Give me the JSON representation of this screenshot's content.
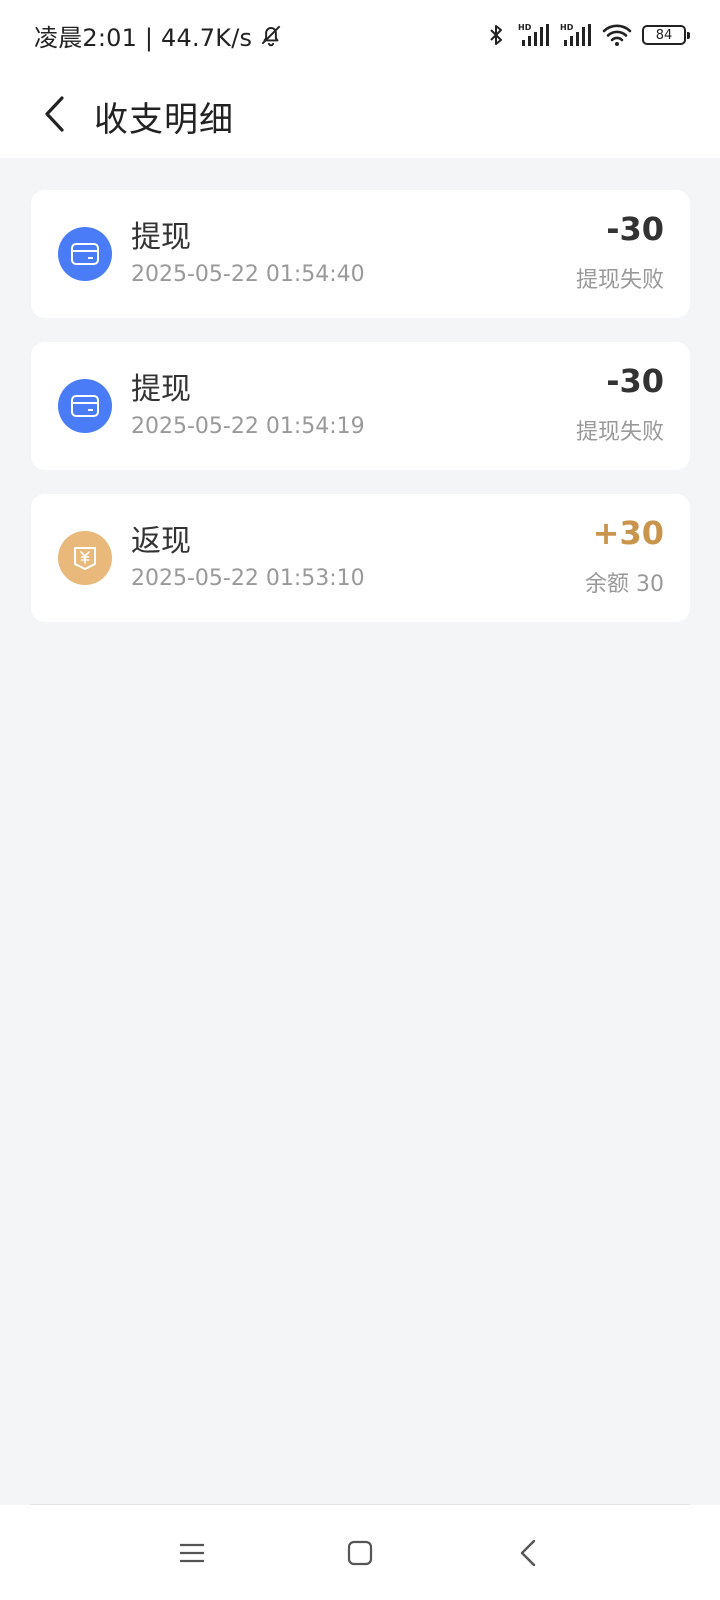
{
  "status_bar": {
    "time_speed": "凌晨2:01 | 44.7K/s",
    "battery": "84",
    "icons": [
      "bell-off-icon",
      "bluetooth-icon",
      "signal-hd-icon",
      "signal-hd-icon",
      "wifi-icon",
      "battery-icon"
    ]
  },
  "header": {
    "title": "收支明细",
    "back_icon": "chevron-left-icon"
  },
  "transactions": [
    {
      "title": "提现",
      "time": "2025-05-22 01:54:40",
      "amount": "-30",
      "note": "提现失败",
      "icon": "card-icon",
      "icon_color": "#4a7cf7",
      "amount_color": "#333333"
    },
    {
      "title": "提现",
      "time": "2025-05-22 01:54:19",
      "amount": "-30",
      "note": "提现失败",
      "icon": "card-icon",
      "icon_color": "#4a7cf7",
      "amount_color": "#333333"
    },
    {
      "title": "返现",
      "time": "2025-05-22 01:53:10",
      "amount": "+30",
      "note": "余额 30",
      "icon": "yuan-coupon-icon",
      "icon_color": "#e8b97a",
      "amount_color": "#c9954c"
    }
  ],
  "nav_bar": {
    "icons": [
      "menu-icon",
      "home-square-icon",
      "back-triangle-icon"
    ]
  }
}
